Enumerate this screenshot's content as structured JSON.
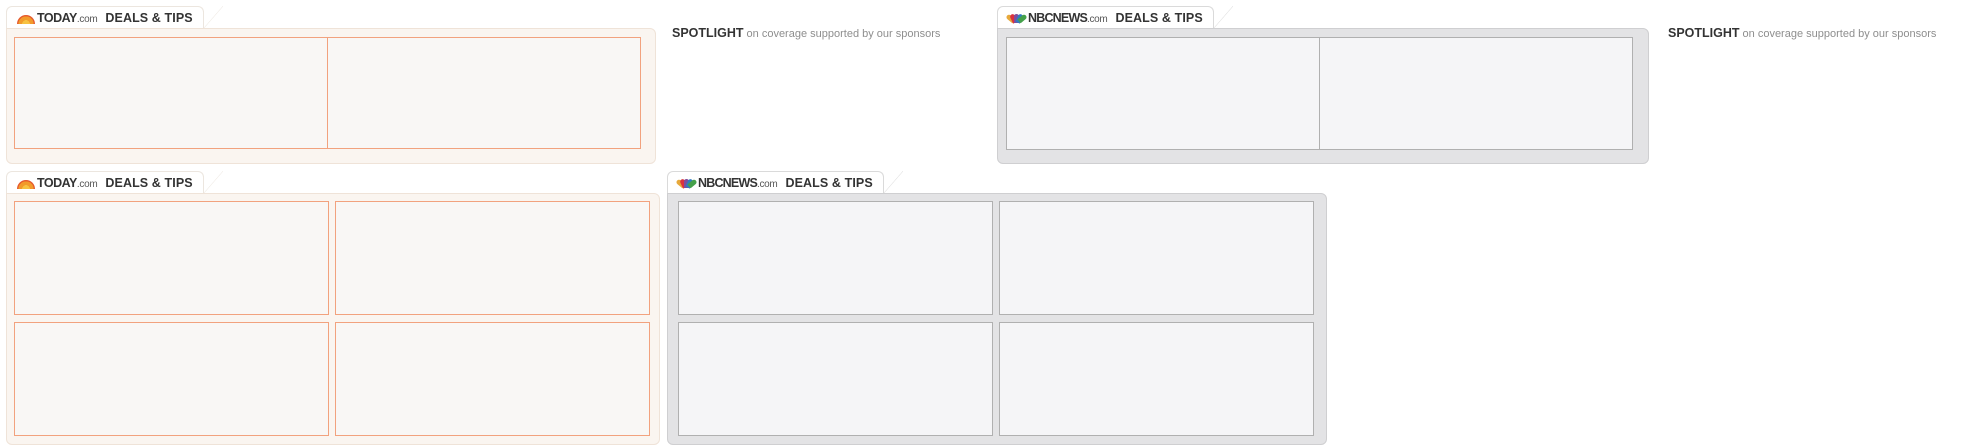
{
  "today_logo": {
    "brand": "TODAY",
    "suffix": ".com"
  },
  "nbc_logo": {
    "brand": "NBCNEWS",
    "suffix": ".com"
  },
  "widget_title": "DEALS & TIPS",
  "spotlight": {
    "label": "SPOTLIGHT",
    "text": "on coverage supported by our sponsors"
  },
  "colors": {
    "today_accent": "#f2a27e",
    "today_panel": "#faf5f0",
    "nbc_panel": "#e3e3e5",
    "nbc_slot_border": "#b0b0b0"
  },
  "icons": {
    "today": "today-sun-logo-icon",
    "nbc": "nbc-peacock-logo-icon"
  }
}
